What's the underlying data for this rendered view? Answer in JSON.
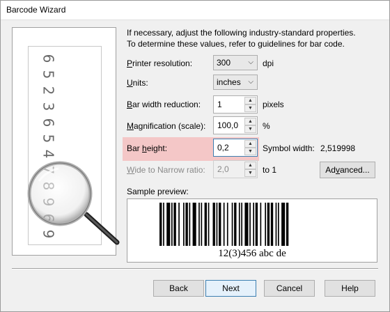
{
  "window": {
    "title": "Barcode Wizard"
  },
  "illustration": {
    "digits": [
      "6",
      "5",
      "2",
      "3",
      "6",
      "5",
      "4",
      "7",
      "8",
      "9",
      "6",
      "9"
    ]
  },
  "instructions": {
    "line1": "If necessary, adjust the following industry-standard properties.",
    "line2": "To determine these values, refer to guidelines for bar code."
  },
  "fields": {
    "printer_resolution": {
      "label_u": "P",
      "label_rest": "rinter resolution:",
      "value": "300",
      "unit": "dpi"
    },
    "units": {
      "label_u": "U",
      "label_rest": "nits:",
      "value": "inches"
    },
    "bar_width_reduction": {
      "label_u": "B",
      "label_rest": "ar width reduction:",
      "value": "1",
      "unit": "pixels"
    },
    "magnification": {
      "label_u": "M",
      "label_rest": "agnification (scale):",
      "value": "100,0",
      "unit": "%"
    },
    "bar_height": {
      "label_pre": "Bar ",
      "label_u": "h",
      "label_rest": "eight:",
      "value": "0,2"
    },
    "symbol_width": {
      "label": "Symbol width:",
      "value": "2,519998"
    },
    "wide_to_narrow": {
      "label_u": "W",
      "label_rest": "ide to Narrow ratio:",
      "value": "2,0",
      "unit": "to 1"
    }
  },
  "advanced_button": {
    "label_pre": "Ad",
    "label_u": "v",
    "label_rest": "anced..."
  },
  "sample_preview": {
    "label": "Sample preview:",
    "caption": "12(3)456 abc de"
  },
  "footer": {
    "back": "Back",
    "next": "Next",
    "cancel": "Cancel",
    "help": "Help"
  }
}
